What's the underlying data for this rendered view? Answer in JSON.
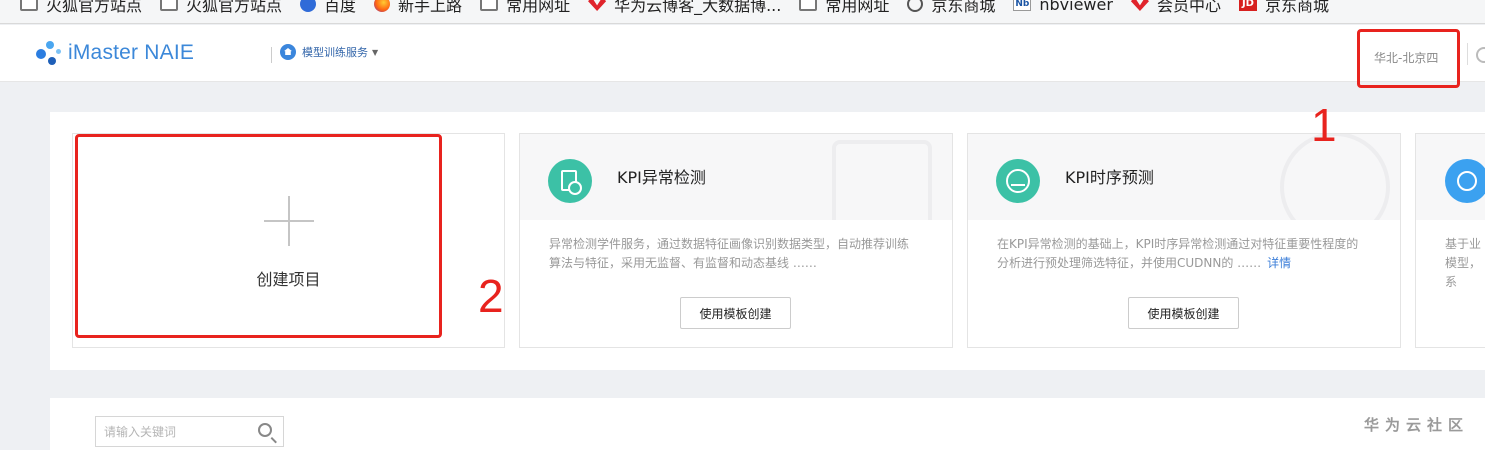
{
  "bookmarks": [
    {
      "label": "火狐官方站点",
      "icon": "folder-icon"
    },
    {
      "label": "火狐官方站点",
      "icon": "folder-icon"
    },
    {
      "label": "百度",
      "icon": "baidu-icon"
    },
    {
      "label": "新手上路",
      "icon": "firefox-icon"
    },
    {
      "label": "常用网址",
      "icon": "folder-icon"
    },
    {
      "label": "华为云博客_大数据博...",
      "icon": "huawei-icon"
    },
    {
      "label": "常用网址",
      "icon": "folder-icon"
    },
    {
      "label": "京东商城",
      "icon": "globe-icon"
    },
    {
      "label": "nbviewer",
      "icon": "nbviewer-icon"
    },
    {
      "label": "会员中心",
      "icon": "huawei-icon"
    },
    {
      "label": "京东商城",
      "icon": "jd-icon"
    }
  ],
  "header": {
    "logo_text": "iMaster NAIE",
    "service_menu": "模型训练服务",
    "region": "华北-北京四"
  },
  "annotations": {
    "label_1": "1",
    "label_2": "2",
    "color": "#e8231e"
  },
  "create_card": {
    "label": "创建项目"
  },
  "templates": [
    {
      "title": "KPI异常检测",
      "description": "异常检测学件服务，通过数据特征画像识别数据类型，自动推荐训练算法与特征，采用无监督、有监督和动态基线 ……",
      "more": "",
      "button": "使用模板创建",
      "icon": "document-alert-icon",
      "color": "#3cc1a6"
    },
    {
      "title": "KPI时序预测",
      "description": "在KPI异常检测的基础上，KPI时序异常检测通过对特征重要性程度的分析进行预处理筛选特征，并使用CUDNN的 ……",
      "more": "详情",
      "button": "使用模板创建",
      "icon": "pulse-icon",
      "color": "#3cc1a6"
    },
    {
      "title": "",
      "description": "基于业 模型，系",
      "more": "",
      "button": "",
      "icon": "gauge-icon",
      "color": "#3ba1f0"
    }
  ],
  "search": {
    "placeholder": "请输入关键词"
  },
  "watermark": "华为云社区"
}
